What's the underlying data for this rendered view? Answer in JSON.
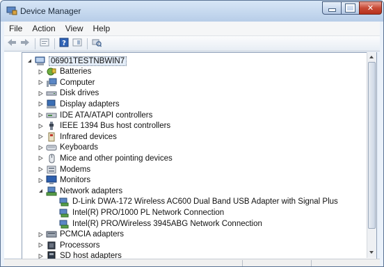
{
  "window": {
    "title": "Device Manager"
  },
  "menu": [
    "File",
    "Action",
    "View",
    "Help"
  ],
  "toolbar": [
    "back-icon",
    "forward-icon",
    "properties-icon",
    "help-icon",
    "show-view-icon",
    "scan-hardware-icon"
  ],
  "tree": {
    "root": "06901TESTNBWIN7",
    "items": [
      {
        "label": "Batteries",
        "icon": "battery-icon",
        "expanded": false
      },
      {
        "label": "Computer",
        "icon": "computer-icon",
        "expanded": false
      },
      {
        "label": "Disk drives",
        "icon": "disk-drive-icon",
        "expanded": false
      },
      {
        "label": "Display adapters",
        "icon": "display-adapter-icon",
        "expanded": false
      },
      {
        "label": "IDE ATA/ATAPI controllers",
        "icon": "ide-controller-icon",
        "expanded": false
      },
      {
        "label": "IEEE 1394 Bus host controllers",
        "icon": "ieee1394-icon",
        "expanded": false
      },
      {
        "label": "Infrared devices",
        "icon": "infrared-icon",
        "expanded": false
      },
      {
        "label": "Keyboards",
        "icon": "keyboard-icon",
        "expanded": false
      },
      {
        "label": "Mice and other pointing devices",
        "icon": "mouse-icon",
        "expanded": false
      },
      {
        "label": "Modems",
        "icon": "modem-icon",
        "expanded": false
      },
      {
        "label": "Monitors",
        "icon": "monitor-icon",
        "expanded": false
      },
      {
        "label": "Network adapters",
        "icon": "network-adapter-icon",
        "expanded": true,
        "children": [
          "D-Link DWA-172 Wireless AC600 Dual Band USB Adapter with Signal Plus",
          "Intel(R) PRO/1000 PL Network Connection",
          "Intel(R) PRO/Wireless 3945ABG Network Connection"
        ]
      },
      {
        "label": "PCMCIA adapters",
        "icon": "pcmcia-icon",
        "expanded": false
      },
      {
        "label": "Processors",
        "icon": "processor-icon",
        "expanded": false
      },
      {
        "label": "SD host adapters",
        "icon": "sd-host-icon",
        "expanded": false
      }
    ]
  },
  "colors": {
    "titlebar": "#c3d6ee",
    "close": "#c74a36",
    "selection": "#e3ecf7"
  }
}
